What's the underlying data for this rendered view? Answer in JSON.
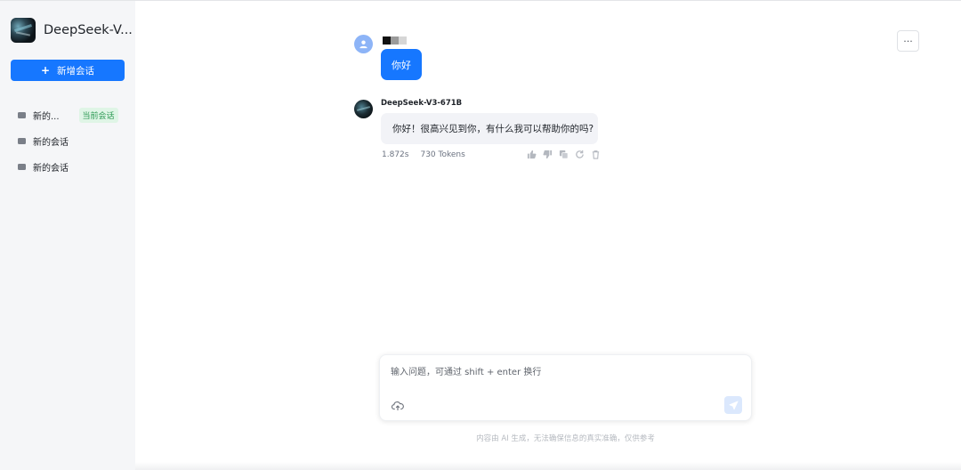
{
  "sidebar": {
    "app_name": "DeepSeek-V...",
    "new_chat_label": "新增会话",
    "conversations": [
      {
        "title": "新的...",
        "badge": "当前会话"
      },
      {
        "title": "新的会话"
      },
      {
        "title": "新的会话"
      }
    ]
  },
  "header": {
    "more_label": "···"
  },
  "messages": {
    "user": {
      "text": "你好"
    },
    "assistant": {
      "name": "DeepSeek-V3-671B",
      "text": "你好！很高兴见到你，有什么我可以帮助你的吗?",
      "duration": "1.872s",
      "tokens": "730 Tokens",
      "actions": [
        "thumbs-up-icon",
        "thumbs-down-icon",
        "copy-icon",
        "regenerate-icon",
        "delete-icon"
      ]
    }
  },
  "composer": {
    "placeholder": "输入问题，可通过 shift + enter 换行",
    "disclaimer": "内容由 AI 生成，无法确保信息的真实准确，仅供参考"
  },
  "colors": {
    "accent": "#1677ff",
    "sidebar_bg": "#f5f6f8",
    "badge_bg": "#dff5e6",
    "badge_text": "#2e9a55"
  }
}
